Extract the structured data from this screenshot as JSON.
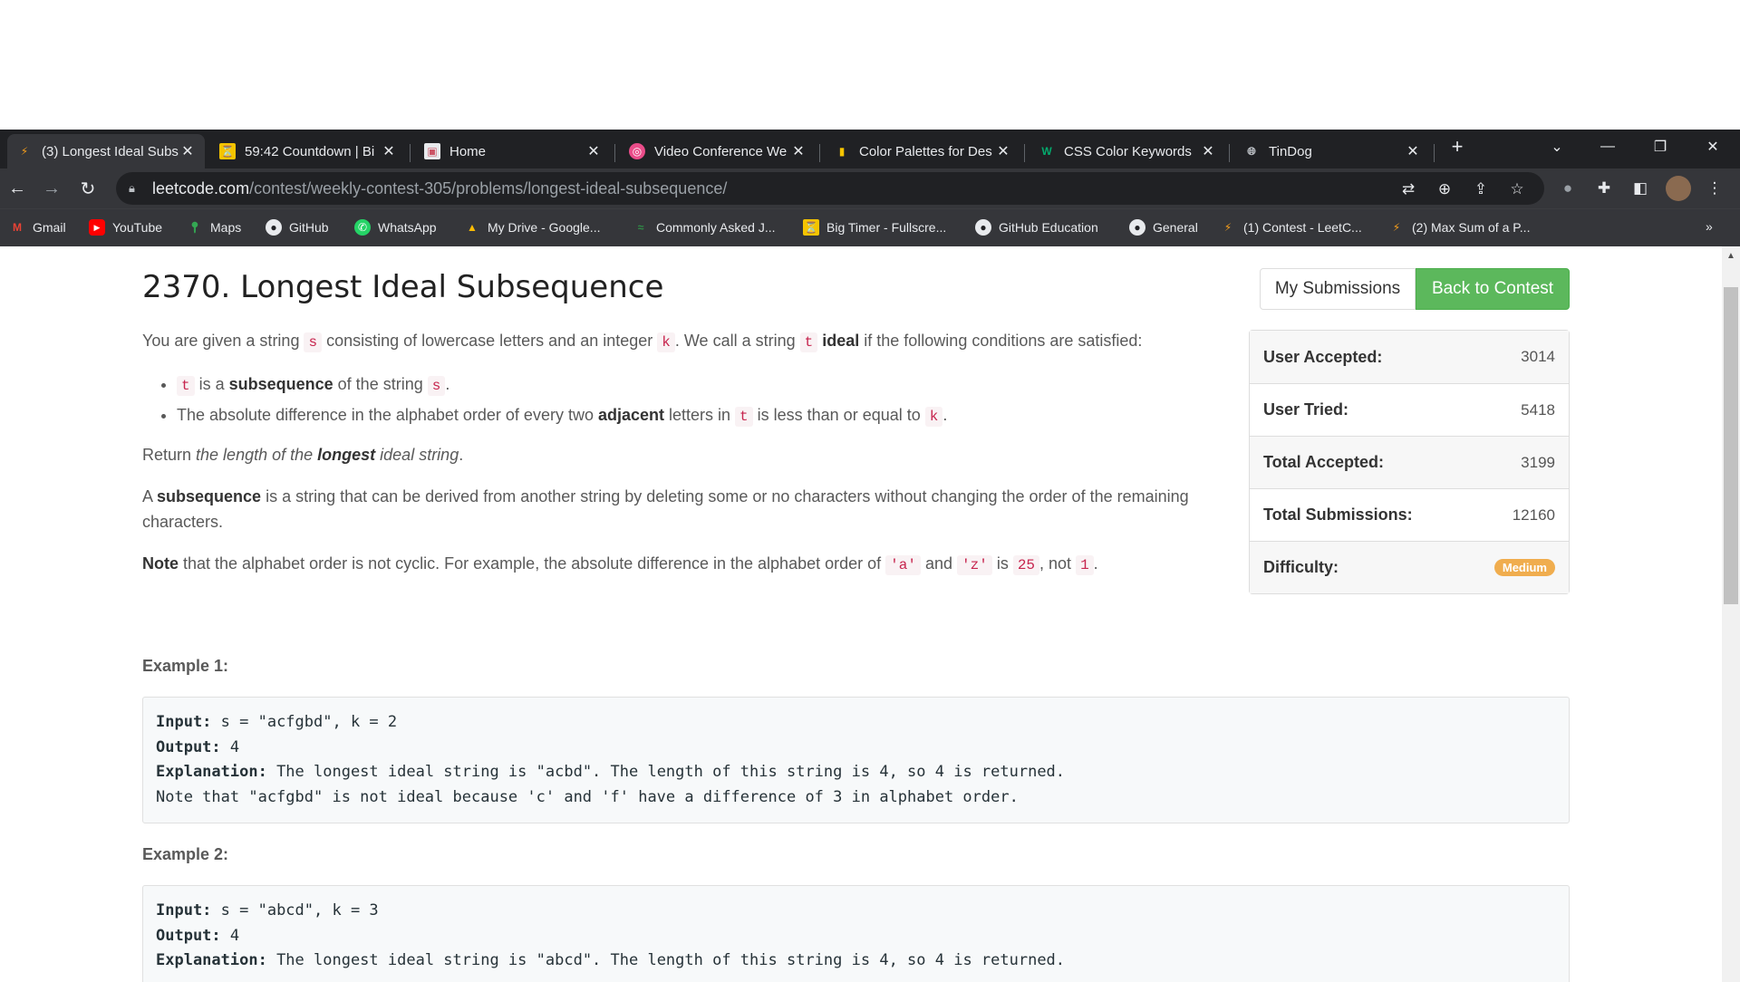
{
  "browser": {
    "tabs": [
      {
        "title": "(3) Longest Ideal Subs",
        "active": true
      },
      {
        "title": "59:42 Countdown | Bi",
        "active": false
      },
      {
        "title": "Home",
        "active": false
      },
      {
        "title": "Video Conference We",
        "active": false
      },
      {
        "title": "Color Palettes for Des",
        "active": false
      },
      {
        "title": "CSS Color Keywords",
        "active": false
      },
      {
        "title": "TinDog",
        "active": false
      }
    ],
    "url_host": "leetcode.com",
    "url_path": "/contest/weekly-contest-305/problems/longest-ideal-subsequence/",
    "bookmarks": [
      "Gmail",
      "YouTube",
      "Maps",
      "GitHub",
      "WhatsApp",
      "My Drive - Google...",
      "Commonly Asked J...",
      "Big Timer - Fullscre...",
      "GitHub Education",
      "General",
      "(1) Contest - LeetC...",
      "(2) Max Sum of a P..."
    ],
    "more_bookmarks": "»"
  },
  "problem": {
    "title": "2370. Longest Ideal Subsequence",
    "intro": {
      "t1": "You are given a string ",
      "s": "s",
      "t2": " consisting of lowercase letters and an integer ",
      "k": "k",
      "t3": ". We call a string ",
      "t": "t",
      "t4": " ",
      "ideal": "ideal",
      "t5": " if the following conditions are satisfied:"
    },
    "bullet1": {
      "t": "t",
      "a": " is a ",
      "b": "subsequence",
      "c": " of the string ",
      "s": "s",
      "d": "."
    },
    "bullet2": {
      "a": "The absolute difference in the alphabet order of every two ",
      "b": "adjacent",
      "c": " letters in ",
      "t": "t",
      "d": " is less than or equal to ",
      "k": "k",
      "e": "."
    },
    "return": {
      "a": "Return ",
      "b": "the length of the ",
      "c": "longest",
      "d": " ideal string",
      "e": "."
    },
    "subseq": {
      "b": "subsequence",
      "a": "A ",
      "c": " is a string that can be derived from another string by deleting some or no characters without changing the order of the remaining characters."
    },
    "note": {
      "b": "Note",
      "a": " that the alphabet order is not cyclic. For example, the absolute difference in the alphabet order of ",
      "c1": "'a'",
      "and": " and ",
      "c2": "'z'",
      "is": " is ",
      "n25": "25",
      "not": ", not ",
      "n1": "1",
      "end": "."
    },
    "example1": {
      "heading": "Example 1:",
      "input_label": "Input:",
      "input": " s = \"acfgbd\", k = 2",
      "output_label": "Output:",
      "output": " 4",
      "expl_label": "Explanation:",
      "expl": " The longest ideal string is \"acbd\". The length of this string is 4, so 4 is returned.",
      "note": "Note that \"acfgbd\" is not ideal because 'c' and 'f' have a difference of 3 in alphabet order."
    },
    "example2": {
      "heading": "Example 2:",
      "input_label": "Input:",
      "input": " s = \"abcd\", k = 3",
      "output_label": "Output:",
      "output": " 4",
      "expl_label": "Explanation:",
      "expl": " The longest ideal string is \"abcd\". The length of this string is 4, so 4 is returned."
    }
  },
  "buttons": {
    "my_submissions": "My Submissions",
    "back_to_contest": "Back to Contest"
  },
  "stats": [
    {
      "label": "User Accepted:",
      "value": "3014"
    },
    {
      "label": "User Tried:",
      "value": "5418"
    },
    {
      "label": "Total Accepted:",
      "value": "3199"
    },
    {
      "label": "Total Submissions:",
      "value": "12160"
    }
  ],
  "difficulty": {
    "label": "Difficulty:",
    "value": "Medium",
    "color": "#f0ad4e"
  },
  "colors": {
    "accent_green": "#5cb85c",
    "code_red": "#c7254e",
    "chrome_dark": "#202124"
  }
}
